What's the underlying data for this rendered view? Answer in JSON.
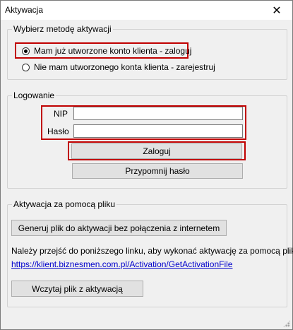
{
  "window": {
    "title": "Aktywacja",
    "close_glyph": "✕"
  },
  "method_group": {
    "legend": "Wybierz metodę aktywacji",
    "options": [
      {
        "label": "Mam już utworzone konto klienta - zaloguj",
        "selected": true
      },
      {
        "label": "Nie mam utworzonego konta klienta - zarejestruj",
        "selected": false
      }
    ]
  },
  "login_group": {
    "legend": "Logowanie",
    "nip_label": "NIP",
    "nip_value": "",
    "password_label": "Hasło",
    "password_value": "",
    "login_button": "Zaloguj",
    "remind_button": "Przypomnij hasło"
  },
  "file_group": {
    "legend": "Aktywacja za pomocą pliku",
    "generate_button": "Generuj plik do aktywacji bez połączenia z internetem",
    "instruction": "Należy przejść do poniższego linku, aby wykonać aktywację za pomocą pliku",
    "link": "https://klient.biznesmen.com.pl/Activation/GetActivationFile",
    "load_button": "Wczytaj plik z aktywacją"
  },
  "colors": {
    "highlight": "#c00000",
    "link": "#0000cc"
  }
}
